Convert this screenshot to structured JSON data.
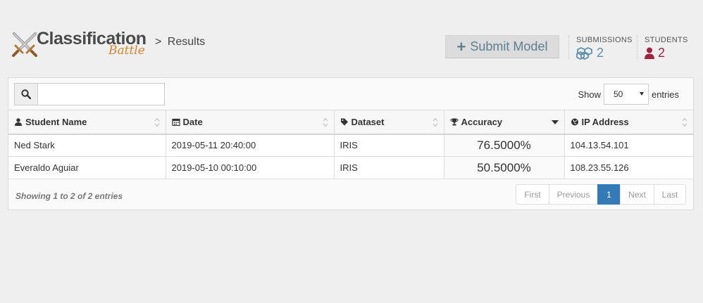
{
  "header": {
    "logo_title": "Classification",
    "logo_subtitle": "Battle",
    "breadcrumb_sep": ">",
    "breadcrumb_page": "Results",
    "submit_label": "Submit Model",
    "stats": {
      "submissions_label": "SUBMISSIONS",
      "submissions_value": "2",
      "students_label": "STUDENTS",
      "students_value": "2"
    }
  },
  "controls": {
    "search_placeholder": "",
    "search_value": "",
    "show_label": "Show",
    "entries_label": "entries",
    "page_length": "50"
  },
  "table": {
    "columns": [
      {
        "label": "Student Name",
        "icon": "user-icon"
      },
      {
        "label": "Date",
        "icon": "calendar-icon"
      },
      {
        "label": "Dataset",
        "icon": "tag-icon"
      },
      {
        "label": "Accuracy",
        "icon": "trophy-icon",
        "sorted": "desc"
      },
      {
        "label": "IP Address",
        "icon": "globe-icon"
      }
    ],
    "rows": [
      {
        "name": "Ned Stark",
        "date": "2019-05-11 20:40:00",
        "dataset": "IRIS",
        "accuracy": "76.5000%",
        "ip": "104.13.54.101"
      },
      {
        "name": "Everaldo Aguiar",
        "date": "2019-05-10 00:10:00",
        "dataset": "IRIS",
        "accuracy": "50.5000%",
        "ip": "108.23.55.126"
      }
    ]
  },
  "footer": {
    "info": "Showing 1 to 2 of 2 entries",
    "pager": {
      "first": "First",
      "previous": "Previous",
      "current": "1",
      "next": "Next",
      "last": "Last"
    }
  },
  "colors": {
    "accent": "#337ab7",
    "accuracy_high": "#6fb237",
    "accuracy_mid": "#a7b83a",
    "students": "#a0233f",
    "submissions": "#5f8fae"
  }
}
